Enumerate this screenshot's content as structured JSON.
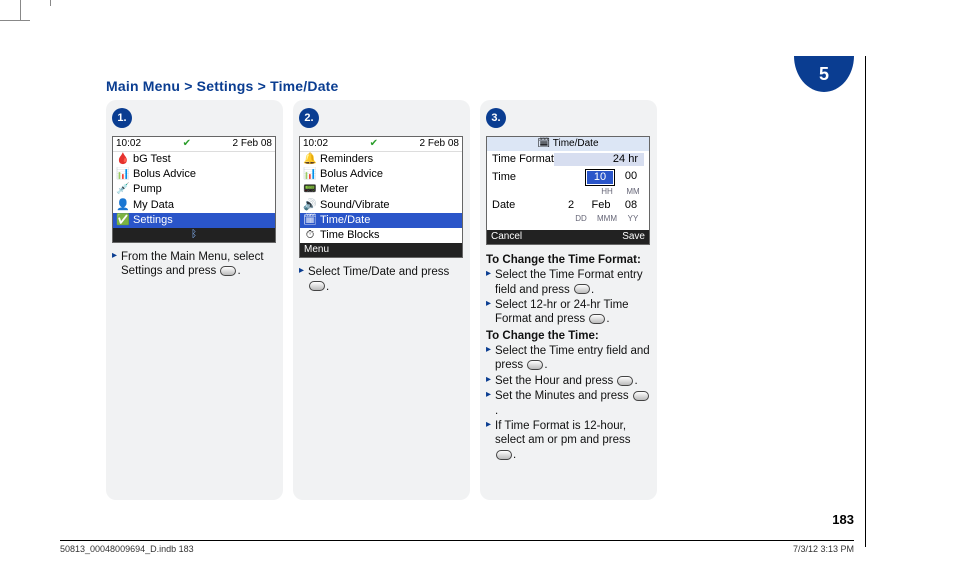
{
  "chapter": "5",
  "breadcrumb": "Main Menu > Settings > Time/Date",
  "page_number": "183",
  "footer_left": "50813_00048009694_D.indb   183",
  "footer_right": "7/3/12   3:13 PM",
  "step1": {
    "badge": "1.",
    "screen": {
      "time": "10:02",
      "date": "2 Feb 08",
      "items": [
        {
          "icon": "🩸",
          "label": "bG Test"
        },
        {
          "icon": "📊",
          "label": "Bolus Advice"
        },
        {
          "icon": "💉",
          "label": "Pump"
        },
        {
          "icon": "👤",
          "label": "My Data"
        },
        {
          "icon": "✅",
          "label": "Settings",
          "selected": true
        }
      ],
      "bt_glyph": "ᛒ"
    },
    "instr1": "From the Main Menu, select Settings and press ",
    "instr1b": "."
  },
  "step2": {
    "badge": "2.",
    "screen": {
      "time": "10:02",
      "date": "2 Feb 08",
      "items": [
        {
          "icon": "🔔",
          "label": "Reminders"
        },
        {
          "icon": "📊",
          "label": "Bolus Advice"
        },
        {
          "icon": "📟",
          "label": "Meter"
        },
        {
          "icon": "🔊",
          "label": "Sound/Vibrate"
        },
        {
          "icon": "🗓",
          "label": "Time/Date",
          "selected": true
        },
        {
          "icon": "⏱",
          "label": "Time Blocks"
        }
      ],
      "softkey": "Menu"
    },
    "instr1": "Select Time/Date and press ",
    "instr1b": "."
  },
  "step3": {
    "badge": "3.",
    "screen": {
      "title_icon": "🗓",
      "title": "Time/Date",
      "format_label": "Time Format",
      "format_value": "24 hr",
      "time_label": "Time",
      "time_hh": "10",
      "time_mm": "00",
      "hh_unit": "HH",
      "mm_unit": "MM",
      "date_label": "Date",
      "date_dd": "2",
      "date_mmm": "Feb",
      "date_yy": "08",
      "dd_unit": "DD",
      "mmm_unit": "MMM",
      "yy_unit": "YY",
      "soft_left": "Cancel",
      "soft_right": "Save"
    },
    "h1": "To Change the Time Format:",
    "b1a": "Select the Time Format entry field and press ",
    "b1b": ".",
    "b2a": "Select 12-hr or 24-hr Time Format and press ",
    "b2b": ".",
    "h2": "To Change the Time:",
    "b3a": "Select the Time entry field and press ",
    "b3b": ".",
    "b4a": "Set the Hour and press ",
    "b4b": ".",
    "b5a": "Set the Minutes and press ",
    "b5b": ".",
    "b6a": "If Time Format is 12-hour, select am or pm and press ",
    "b6b": "."
  }
}
